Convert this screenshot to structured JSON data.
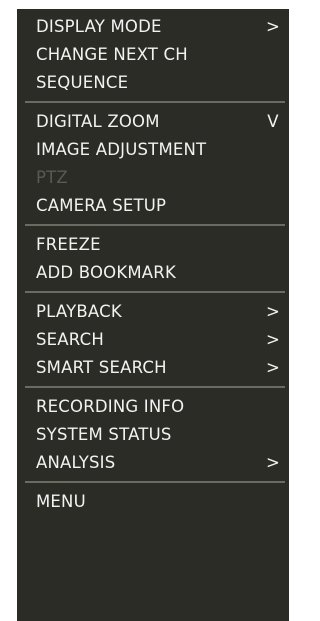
{
  "menu": {
    "groups": [
      {
        "items": [
          {
            "label": "DISPLAY MODE",
            "indicator": ">"
          },
          {
            "label": "CHANGE NEXT CH",
            "indicator": ""
          },
          {
            "label": "SEQUENCE",
            "indicator": ""
          }
        ]
      },
      {
        "items": [
          {
            "label": "DIGITAL ZOOM",
            "indicator": "V"
          },
          {
            "label": "IMAGE ADJUSTMENT",
            "indicator": ""
          },
          {
            "label": "PTZ",
            "indicator": "",
            "disabled": true
          },
          {
            "label": "CAMERA SETUP",
            "indicator": ""
          }
        ]
      },
      {
        "items": [
          {
            "label": "FREEZE",
            "indicator": ""
          },
          {
            "label": "ADD BOOKMARK",
            "indicator": ""
          }
        ]
      },
      {
        "items": [
          {
            "label": "PLAYBACK",
            "indicator": ">"
          },
          {
            "label": "SEARCH",
            "indicator": ">"
          },
          {
            "label": "SMART SEARCH",
            "indicator": ">"
          }
        ]
      },
      {
        "items": [
          {
            "label": "RECORDING INFO",
            "indicator": ""
          },
          {
            "label": "SYSTEM STATUS",
            "indicator": ""
          },
          {
            "label": "ANALYSIS",
            "indicator": ">"
          }
        ]
      },
      {
        "items": [
          {
            "label": "MENU",
            "indicator": ""
          }
        ]
      }
    ],
    "colors": {
      "background": "#2b2c25",
      "text": "#f2f2f2",
      "disabled_text": "#5a5a55",
      "separator": "#6b6b64"
    }
  }
}
